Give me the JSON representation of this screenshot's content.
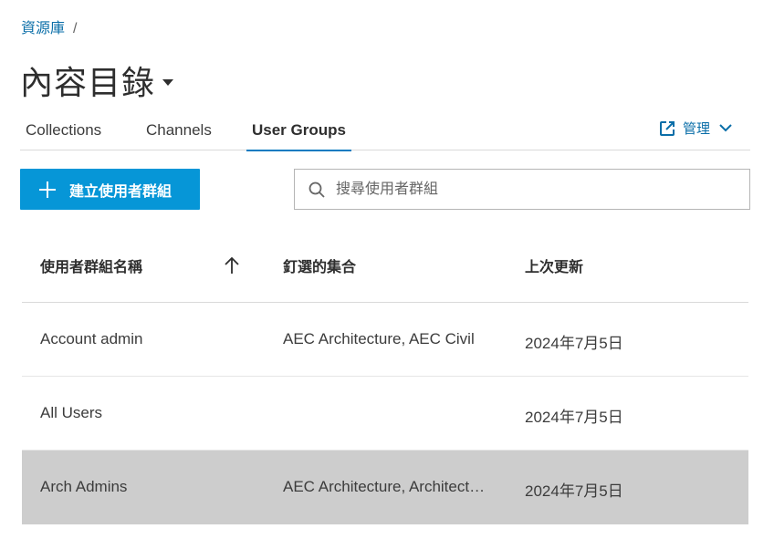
{
  "breadcrumb": {
    "root": "資源庫",
    "separator": "/"
  },
  "page": {
    "title": "內容目錄"
  },
  "tabs": [
    {
      "label": "Collections",
      "active": false
    },
    {
      "label": "Channels",
      "active": false
    },
    {
      "label": "User Groups",
      "active": true
    }
  ],
  "manage": {
    "label": "管理",
    "icon": "external-link-icon"
  },
  "toolbar": {
    "create_label": "建立使用者群組",
    "search_placeholder": "搜尋使用者群組"
  },
  "table": {
    "columns": [
      "使用者群組名稱",
      "釘選的集合",
      "上次更新"
    ],
    "rows": [
      {
        "name": "Account admin",
        "pinned": "AEC Architecture, AEC Civil",
        "updated": "2024年7月5日",
        "selected": false
      },
      {
        "name": "All Users",
        "pinned": "",
        "updated": "2024年7月5日",
        "selected": false
      },
      {
        "name": "Arch Admins",
        "pinned": "AEC Architecture, Architecture",
        "updated": "2024年7月5日",
        "selected": true
      }
    ]
  },
  "colors": {
    "accent": "#0696d7",
    "link": "#0a6ea8",
    "tab_underline": "#0a7bc1",
    "selected_row": "#cdcdcd"
  }
}
